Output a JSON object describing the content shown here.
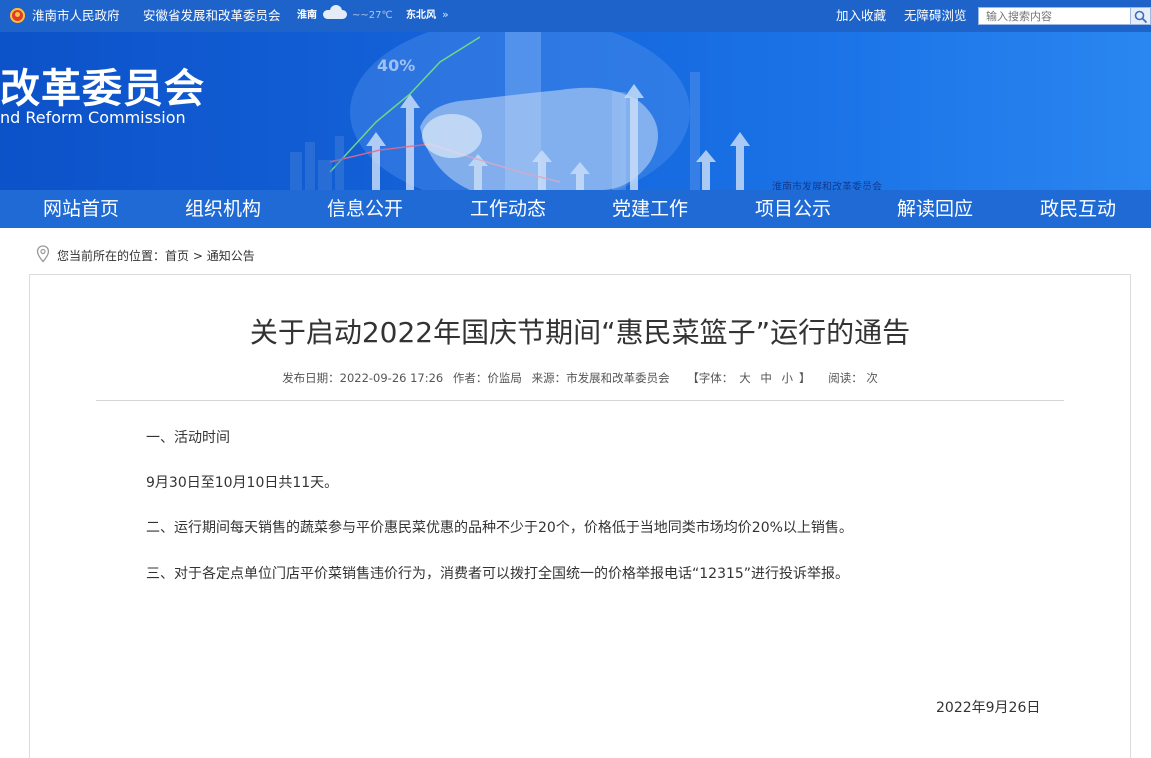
{
  "topbar": {
    "gov_link": "淮南市人民政府",
    "dept_link": "安徽省发展和改革委员会",
    "weather": {
      "city": "淮南",
      "temp": "~~27℃",
      "wind": "东北风",
      "icon": "cloud-icon"
    },
    "favorite": "加入收藏",
    "accessibility": "无障碍浏览",
    "search_placeholder": "输入搜索内容"
  },
  "banner": {
    "title": "改革委员会",
    "subtitle": "nd Reform Commission",
    "percent": "40%",
    "watermark": "淮南市发展和改革委员会"
  },
  "nav": {
    "items": [
      {
        "label": "网站首页"
      },
      {
        "label": "组织机构"
      },
      {
        "label": "信息公开"
      },
      {
        "label": "工作动态"
      },
      {
        "label": "党建工作"
      },
      {
        "label": "项目公示"
      },
      {
        "label": "解读回应"
      },
      {
        "label": "政民互动"
      }
    ]
  },
  "breadcrumb": {
    "prefix": "您当前所在的位置：",
    "home": "首页",
    "sep": " > ",
    "current": "通知公告"
  },
  "article": {
    "title": "关于启动2022年国庆节期间“惠民菜篮子”运行的通告",
    "meta": {
      "date": "发布日期：2022-09-26 17:26",
      "author": "作者：价监局",
      "source": "来源：市发展和改革委员会",
      "font_prefix": "【字体：",
      "font_large": "大",
      "font_medium": "中",
      "font_small": "小",
      "font_suffix": "】",
      "reads": "阅读： 次"
    },
    "paragraphs": [
      "一、活动时间",
      "9月30日至10月10日共11天。",
      "二、运行期间每天销售的蔬菜参与平价惠民菜优惠的品种不少于20个，价格低于当地同类市场均价20%以上销售。",
      "三、对于各定点单位门店平价菜销售违价行为，消费者可以拨打全国统一的价格举报电话“12315”进行投诉举报。"
    ],
    "sign_date": "2022年9月26日"
  }
}
